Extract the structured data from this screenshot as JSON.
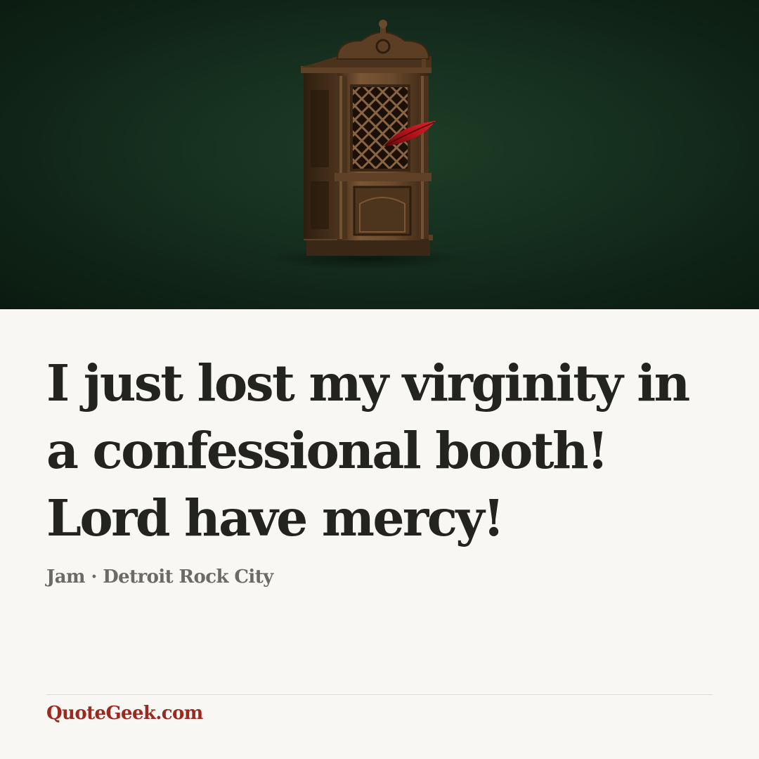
{
  "quote": {
    "text": "I just lost my virginity in a confessional booth! Lord have mercy!",
    "author": "Jam",
    "separator": "·",
    "source": "Detroit Rock City"
  },
  "footer": {
    "brand": "QuoteGeek.com"
  },
  "colors": {
    "background": "#f8f7f3",
    "hero_background": "#163020",
    "quote_text": "#232320",
    "attribution_text": "#6b6a66",
    "brand_text": "#9a2a1f",
    "feather": "#b3121a",
    "wood": "#6b4a2c"
  },
  "illustration": {
    "subject": "confessional-booth-icon",
    "accent": "red-feather-icon"
  }
}
